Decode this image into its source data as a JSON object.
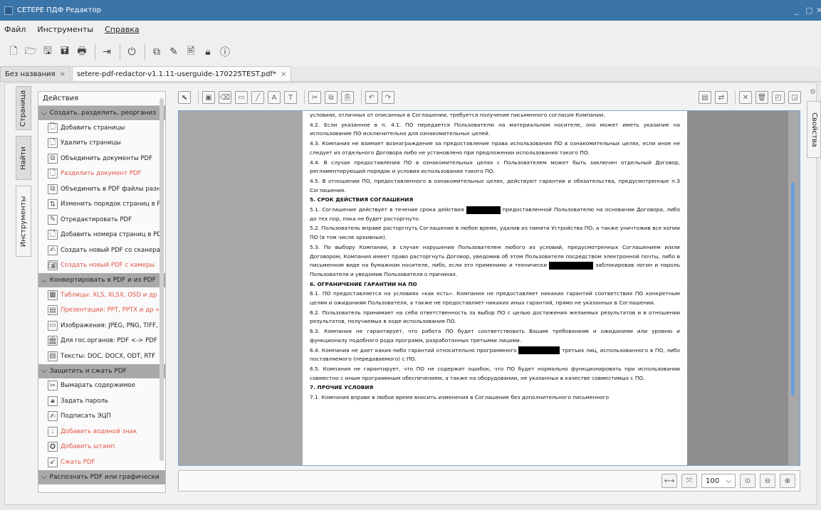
{
  "window": {
    "title": "СЕТЕРЕ ПДФ Редактор",
    "minimize": "_",
    "maximize": "▢",
    "close": "✕"
  },
  "menu": {
    "file": "Файл",
    "tools": "Инструменты",
    "help": "Справка"
  },
  "tabs": [
    {
      "label": "Без названия",
      "close": "×"
    },
    {
      "label": "setere-pdf-redactor-v1.1.11-userguide-170225TEST.pdf*",
      "close": "×"
    }
  ],
  "left_tabs": {
    "page": "Страница",
    "find": "Найти",
    "tools": "Инструменты"
  },
  "panel": {
    "header": "Действия",
    "sections": [
      {
        "title": "Создать, разделить, реорганиз",
        "items": [
          {
            "label": "Добавить страницы",
            "red": false
          },
          {
            "label": "Удалить страницы",
            "red": false
          },
          {
            "label": "Объединить документы PDF",
            "red": false
          },
          {
            "label": "Разделить документ PDF",
            "red": true
          },
          {
            "label": "Объединить в PDF файлы разн",
            "red": false
          },
          {
            "label": "Изменить порядок страниц в P",
            "red": false
          },
          {
            "label": "Отредактировать PDF",
            "red": false
          },
          {
            "label": "Добавить номера страниц в PD",
            "red": false
          },
          {
            "label": "Создать новый PDF со сканера",
            "red": false
          },
          {
            "label": "Создать новый PDF с камеры",
            "red": true
          }
        ]
      },
      {
        "title": "Конвертировать в PDF и из PDF",
        "items": [
          {
            "label": "Таблицы: XLS, XLSX, OSD и др",
            "red": true
          },
          {
            "label": "Презентации: PPT, PPTX и др «",
            "red": true
          },
          {
            "label": "Изображения: JPEG, PNG, TIFF,",
            "red": false
          },
          {
            "label": "Для гос.органов: PDF <-> PDF",
            "red": false
          },
          {
            "label": "Тексты: DOC, DOCX, ODT, RTF",
            "red": false
          }
        ]
      },
      {
        "title": "Защитить и сжать PDF",
        "items": [
          {
            "label": "Вымарать содержимое",
            "red": false
          },
          {
            "label": "Задать пароль",
            "red": false
          },
          {
            "label": "Подписать ЭЦП",
            "red": false
          },
          {
            "label": "Добавить водяной знак",
            "red": true
          },
          {
            "label": "Добавить штамп",
            "red": true
          },
          {
            "label": "Сжать PDF",
            "red": true
          }
        ]
      },
      {
        "title": "Распознать PDF или графически",
        "items": []
      }
    ]
  },
  "document": {
    "paragraphs": [
      {
        "t": "условиях, отличных от описанных в Соглашении, требуется получение письменного согласия Компании.",
        "h": false
      },
      {
        "t": "4.2. Если указанное в п. 4.1. ПО передается Пользователю на материальном носителе, оно может иметь указание на использование ПО исключительно для ознакомительных целей.",
        "h": false
      },
      {
        "t": "4.3. Компания не взимает вознаграждение за предоставление права использования ПО в ознакомительных целях, если иное не следует из отдельного Договора либо не установлено при предложении использования такого ПО.",
        "h": false
      },
      {
        "t": "4.4. В случае предоставления ПО в ознакомительных целях с Пользователем может быть заключен отдельный Договор, регламентирующий порядок и условия использования такого ПО.",
        "h": false
      },
      {
        "t": "4.5. В отношении ПО, предоставленного в ознакомительных целях, действуют гарантии и обязательства, предусмотренные п.3 Соглашения.",
        "h": false
      },
      {
        "t": "5. СРОК ДЕЙСТВИЯ СОГЛАШЕНИЯ",
        "h": true
      },
      {
        "t": "5.1. Соглашение действует в течение срока действия ▇ предоставленной Пользователю на основании Договора, либо до тех пор, пока не будет расторгнуто.",
        "h": false
      },
      {
        "t": "5.2. Пользователь вправе расторгнуть Соглашение в любое время, удалив из памяти Устройства ПО, а также уничтожив все копии ПО (в том числе архивные).",
        "h": false
      },
      {
        "t": "5.3. По выбору Компании, в случае нарушения Пользователем любого из условий, предусмотренных Соглашением и/или Договором, Компания имеет право расторгнуть Договор, уведомив об этом Пользователя посредством электронной почты, либо в письменном виде на бумажном носителе, либо, если это применимо и технически ▇ заблокировав логин и пароль Пользователя и уведомив Пользователя о причинах.",
        "h": false
      },
      {
        "t": "6. ОГРАНИЧЕНИЕ ГАРАНТИИ НА ПО",
        "h": true
      },
      {
        "t": "6.1. ПО предоставляется на условиях «как есть». Компания не предоставляет никаких гарантий соответствия ПО конкретным целям и ожиданиям Пользователя, а также не предоставляет никаких иных гарантий, прямо не указанных в Соглашении.",
        "h": false
      },
      {
        "t": "6.2. Пользователь принимает на себя ответственность за выбор ПО с целью достижения желаемых результатов и в отношении результатов, получаемых в ходе использования ПО.",
        "h": false
      },
      {
        "t": "6.3. Компания не гарантирует, что работа ПО будет соответствовать Вашим требованиям и ожиданиям или уровню и функционалу подобного рода программ, разработанных третьими лицами.",
        "h": false
      },
      {
        "t": "6.4. Компания не дает каких-либо гарантий относительно программного ▇ третьих лиц, использованного в ПО, либо поставляемого (передаваемого) с ПО.",
        "h": false
      },
      {
        "t": "6.5. Компания не гарантирует, что ПО не содержит ошибок, что ПО будет нормально функционировать при использовании совместно с иным программным обеспечением, а также на оборудовании, не указанных в качестве совместимых с ПО.",
        "h": false
      },
      {
        "t": "7. ПРОЧИЕ УСЛОВИЯ",
        "h": true
      },
      {
        "t": "7.1. Компания вправе в любое время вносить изменения в Соглашение без дополнительного письменного",
        "h": false
      }
    ]
  },
  "bottom": {
    "zoom": "100",
    "zoom_arrow": "⌵"
  },
  "right": {
    "properties": "Свойства"
  }
}
